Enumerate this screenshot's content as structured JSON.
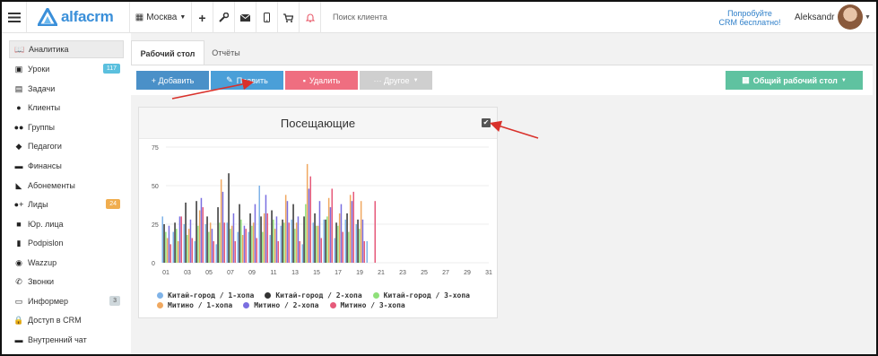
{
  "topbar": {
    "brand": "alfacrm",
    "city": "Москва",
    "search_placeholder": "Поиск клиента",
    "promo_line1": "Попробуйте",
    "promo_line2": "CRM бесплатно!",
    "username": "Aleksandr"
  },
  "sidebar": {
    "items": [
      {
        "label": "Аналитика",
        "icon": "book-icon",
        "active": true
      },
      {
        "label": "Уроки",
        "icon": "calendar-icon",
        "badge": "117",
        "badge_color": "#5bc0de"
      },
      {
        "label": "Задачи",
        "icon": "clipboard-icon"
      },
      {
        "label": "Клиенты",
        "icon": "user-icon"
      },
      {
        "label": "Группы",
        "icon": "users-icon"
      },
      {
        "label": "Педагоги",
        "icon": "graduation-cap-icon"
      },
      {
        "label": "Финансы",
        "icon": "money-icon"
      },
      {
        "label": "Абонементы",
        "icon": "tag-icon"
      },
      {
        "label": "Лиды",
        "icon": "user-plus-icon",
        "badge": "24",
        "badge_color": "#f0ad4e"
      },
      {
        "label": "Юр. лица",
        "icon": "briefcase-icon"
      },
      {
        "label": "Podpislon",
        "icon": "file-icon"
      },
      {
        "label": "Wazzup",
        "icon": "whatsapp-icon"
      },
      {
        "label": "Звонки",
        "icon": "phone-icon"
      },
      {
        "label": "Информер",
        "icon": "inbox-icon",
        "badge": "3",
        "badge_color": "#cfd8dc"
      },
      {
        "label": "Доступ в CRM",
        "icon": "lock-icon"
      },
      {
        "label": "Внутренний чат",
        "icon": "chat-icon"
      }
    ]
  },
  "tabs": {
    "active": "Рабочий стол",
    "second": "Отчёты"
  },
  "toolbar": {
    "add_label": "+ Добавить",
    "edit_label": "Править",
    "delete_label": "Удалить",
    "other_label": "··· Другое",
    "desktop_label": "Общий рабочий стол",
    "colors": {
      "add": "#4a90c8",
      "edit": "#4a9fd8",
      "delete": "#ef6e80",
      "other": "#cfcfcf",
      "desktop": "#5fc2a0"
    }
  },
  "panel": {
    "title": "Посещающие"
  },
  "chart_data": {
    "type": "bar",
    "title": "Посещающие",
    "ylim": [
      0,
      75
    ],
    "yticks": [
      "0",
      "25",
      "50",
      "75"
    ],
    "xticks": [
      "01",
      "03",
      "05",
      "07",
      "09",
      "11",
      "13",
      "15",
      "17",
      "19",
      "21",
      "23",
      "25",
      "27",
      "29",
      "31"
    ],
    "x": [
      1,
      2,
      3,
      4,
      5,
      6,
      7,
      8,
      9,
      10,
      11,
      12,
      13,
      14,
      15,
      16,
      17,
      18,
      19,
      20,
      21,
      22,
      23,
      24,
      25,
      26,
      27,
      28,
      29,
      30,
      31
    ],
    "series": [
      {
        "name": "Китай-город / 1-хопа",
        "color": "#7fb3e8",
        "values": [
          30,
          20,
          25,
          14,
          25,
          12,
          26,
          20,
          20,
          50,
          18,
          24,
          28,
          12,
          26,
          28,
          16,
          28,
          25,
          14,
          0,
          0,
          0,
          0,
          0,
          0,
          0,
          0,
          0,
          0,
          0
        ]
      },
      {
        "name": "Китай-город / 2-хопа",
        "color": "#333333",
        "values": [
          25,
          26,
          39,
          40,
          30,
          36,
          58,
          38,
          32,
          30,
          34,
          28,
          38,
          30,
          32,
          28,
          26,
          32,
          28,
          0,
          0,
          0,
          0,
          0,
          0,
          0,
          0,
          0,
          0,
          0,
          0
        ]
      },
      {
        "name": "Китай-город / 3-хопа",
        "color": "#8fe07a",
        "values": [
          20,
          22,
          18,
          24,
          20,
          26,
          22,
          28,
          24,
          20,
          28,
          26,
          22,
          38,
          24,
          30,
          24,
          20,
          22,
          0,
          0,
          0,
          0,
          0,
          0,
          0,
          0,
          0,
          0,
          0,
          0
        ]
      },
      {
        "name": "Митино / 1-хопа",
        "color": "#f0a860",
        "values": [
          16,
          14,
          22,
          34,
          26,
          54,
          24,
          18,
          26,
          32,
          22,
          44,
          26,
          64,
          24,
          42,
          32,
          44,
          40,
          0,
          0,
          0,
          0,
          0,
          0,
          0,
          0,
          0,
          0,
          0,
          0
        ]
      },
      {
        "name": "Митино / 2-хопа",
        "color": "#7a6ee0",
        "values": [
          24,
          30,
          28,
          42,
          22,
          46,
          32,
          24,
          38,
          44,
          30,
          40,
          30,
          48,
          40,
          36,
          38,
          40,
          28,
          0,
          0,
          0,
          0,
          0,
          0,
          0,
          0,
          0,
          0,
          0,
          0
        ]
      },
      {
        "name": "Митино / 3-хопа",
        "color": "#e65a7a",
        "values": [
          12,
          30,
          16,
          36,
          14,
          26,
          14,
          22,
          16,
          32,
          14,
          26,
          14,
          56,
          16,
          48,
          20,
          46,
          14,
          40,
          0,
          0,
          0,
          0,
          0,
          0,
          0,
          0,
          0,
          0,
          0
        ]
      }
    ],
    "legend_position": "bottom",
    "grid": true
  }
}
